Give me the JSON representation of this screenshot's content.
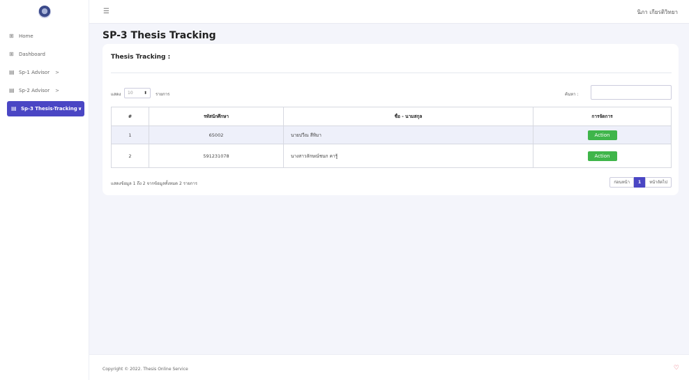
{
  "sidebar": {
    "items": [
      {
        "label": "Home",
        "icon": "grid-icon",
        "chevron": ""
      },
      {
        "label": "Dashboard",
        "icon": "grid-icon",
        "chevron": ""
      },
      {
        "label": "Sp-1 Advisor",
        "icon": "document-icon",
        "chevron": ">"
      },
      {
        "label": "Sp-2 Advisor",
        "icon": "document-icon",
        "chevron": ">"
      },
      {
        "label": "Sp-3 Thesis-Tracking",
        "icon": "document-icon",
        "chevron": "∨"
      }
    ]
  },
  "header": {
    "user_name": "นิภา เกียรติวิทยา",
    "menu_icon": "hamburger-icon"
  },
  "page": {
    "title": "SP-3 Thesis Tracking"
  },
  "card": {
    "title": "Thesis Tracking :"
  },
  "controls": {
    "show_label": "แสดง",
    "page_length": "10",
    "entries_label": "รายการ",
    "search_label": "ค้นหา :"
  },
  "table": {
    "headers": [
      "#",
      "รหัสนักศึกษา",
      "ชื่อ - นามสกุล",
      "การจัดการ"
    ],
    "rows": [
      {
        "no": "1",
        "student_id": "65002",
        "name": "นายปวีณ สีทิมา",
        "action": "Action"
      },
      {
        "no": "2",
        "student_id": "591231078",
        "name": "นางสาวลักษณ์ชนก คารู้",
        "action": "Action"
      }
    ]
  },
  "info": "แสดงข้อมูล 1 ถึง 2 จากข้อมูลทั้งหมด 2 รายการ",
  "pagination": {
    "prev": "ก่อนหน้า",
    "current": "1",
    "next": "หน้าถัดไป"
  },
  "footer": {
    "copyright": "Copyright © 2022. Thesis Online Service"
  },
  "colors": {
    "primary": "#4a46c4",
    "action": "#3fb54a",
    "heart": "#e23c4c"
  }
}
